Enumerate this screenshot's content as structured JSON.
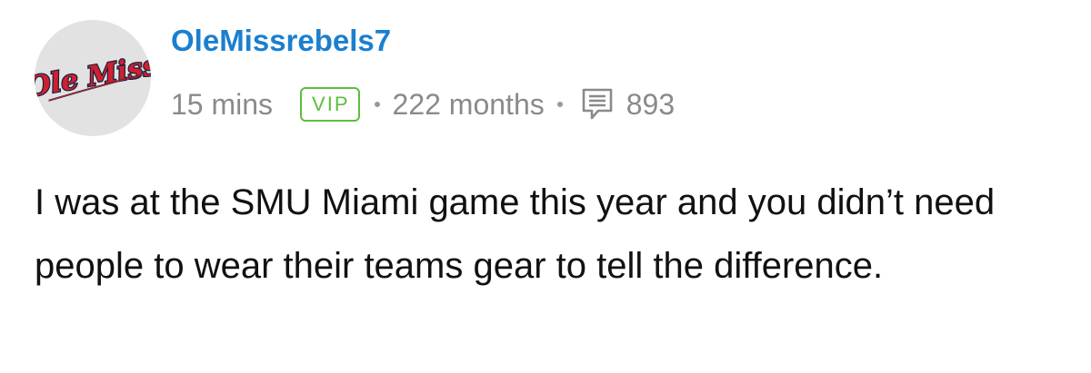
{
  "post": {
    "author": "OleMissrebels7",
    "avatar_logo_text": "Ole Miss",
    "posted_ago": "15 mins",
    "badge": "VIP",
    "membership": "222 months",
    "message_count": "893",
    "body": "I was at the SMU Miami game this year and you didn’t need people to wear their teams gear to tell the difference."
  },
  "colors": {
    "username": "#1b7fcf",
    "vip_badge": "#5cbf3a",
    "meta_text": "#8a8a8a",
    "avatar_bg": "#e2e2e2",
    "logo_red": "#cf2030",
    "logo_navy": "#14213d"
  },
  "icons": {
    "avatar": "ole-miss-logo",
    "messages": "comment-icon"
  }
}
